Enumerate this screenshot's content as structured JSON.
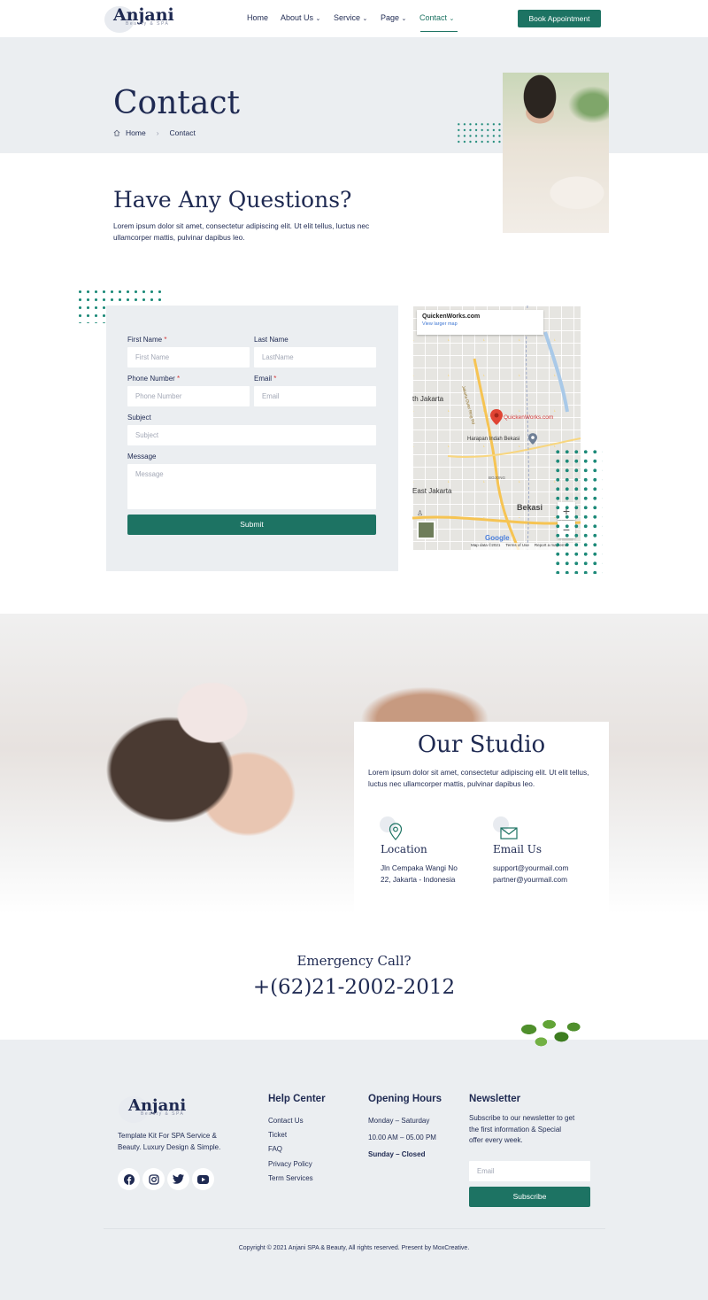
{
  "header": {
    "logo": "Anjani",
    "logo_sub": "Beauty & SPA",
    "nav": [
      {
        "label": "Home"
      },
      {
        "label": "About Us"
      },
      {
        "label": "Service"
      },
      {
        "label": "Page"
      },
      {
        "label": "Contact"
      }
    ],
    "cta": "Book Appointment"
  },
  "hero": {
    "title": "Contact",
    "breadcrumb_home": "Home",
    "breadcrumb_current": "Contact",
    "heading": "Have Any Questions?",
    "text": "Lorem ipsum dolor sit amet, consectetur adipiscing elit. Ut elit tellus, luctus nec ullamcorper mattis, pulvinar dapibus leo."
  },
  "form": {
    "first_name_label": "First Name",
    "first_name_placeholder": "First Name",
    "last_name_label": "Last Name",
    "last_name_placeholder": "LastName",
    "phone_label": "Phone Number",
    "phone_placeholder": "Phone Number",
    "email_label": "Email",
    "email_placeholder": "Email",
    "subject_label": "Subject",
    "subject_placeholder": "Subject",
    "message_label": "Message",
    "message_placeholder": "Message",
    "required_mark": "*",
    "submit": "Submit"
  },
  "map": {
    "place": "QuickenWorks.com",
    "link": "View larger map",
    "marker_label": "QuickenWorks.com",
    "area_1": "th Jakarta",
    "area_2": "East Jakarta",
    "area_3": "Bekasi",
    "area_4": "Harapan Indah Bekasi",
    "area_5": "BOJONG",
    "road": "Jakarta Outer Ring Rd",
    "zoom_in": "+",
    "zoom_out": "−",
    "google": "Google",
    "footer_1": "Map data ©2021",
    "footer_2": "Terms of Use",
    "footer_3": "Report a map error"
  },
  "studio": {
    "title": "Our Studio",
    "text": "Lorem ipsum dolor sit amet, consectetur adipiscing elit. Ut elit tellus, luctus nec ullamcorper mattis, pulvinar dapibus leo.",
    "location_title": "Location",
    "location_line1": "Jln Cempaka Wangi No",
    "location_line2": "22, Jakarta - Indonesia",
    "email_title": "Email Us",
    "email_line1": "support@yourmail.com",
    "email_line2": "partner@yourmail.com"
  },
  "emergency": {
    "label": "Emergency Call?",
    "phone": "+(62)21-2002-2012"
  },
  "footer": {
    "logo": "Anjani",
    "logo_sub": "Beauty & SPA",
    "tagline_1": "Template Kit For SPA Service &",
    "tagline_2": "Beauty. Luxury Design & Simple.",
    "help_title": "Help Center",
    "help_links": [
      "Contact Us",
      "Ticket",
      "FAQ",
      "Privacy Policy",
      "Term Services"
    ],
    "hours_title": "Opening Hours",
    "hours_days": "Monday – Saturday",
    "hours_time": "10.00 AM – 05.00 PM",
    "hours_closed": "Sunday – Closed",
    "newsletter_title": "Newsletter",
    "newsletter_1": "Subscribe to our newsletter to get",
    "newsletter_2": "the first information & Special",
    "newsletter_3": "offer every week.",
    "email_placeholder": "Email",
    "subscribe": "Subscribe",
    "copyright": "Copyright © 2021 Anjani SPA & Beauty, All rights reserved. Present by MoxCreative."
  },
  "colors": {
    "primary": "#1d7363",
    "navy": "#1f2a52",
    "light_bg": "#ebeef1"
  }
}
